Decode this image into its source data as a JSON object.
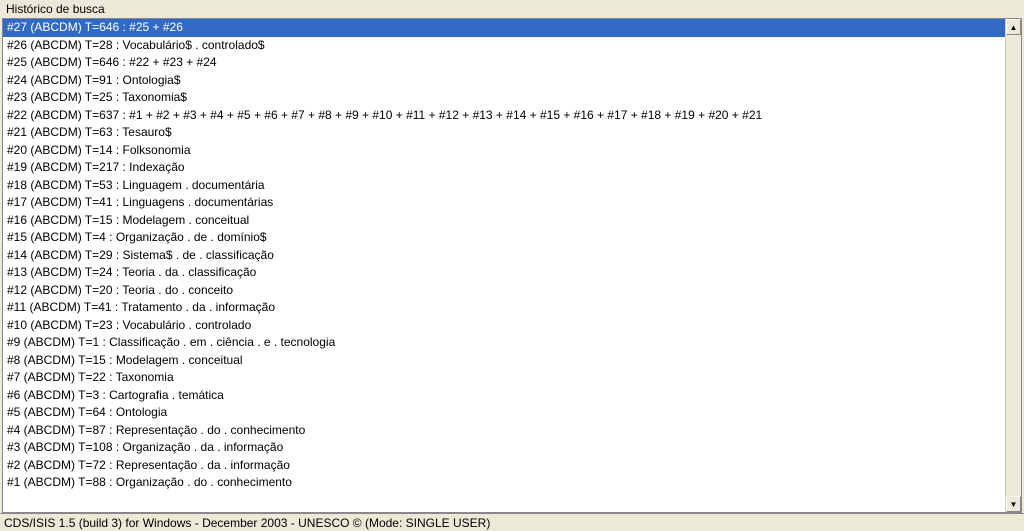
{
  "header": {
    "label": "Histórico de busca"
  },
  "history": {
    "items": [
      "#27 (ABCDM) T=646 : #25 + #26",
      "#26 (ABCDM) T=28 : Vocabulário$ . controlado$",
      "#25 (ABCDM) T=646 : #22 + #23 + #24",
      "#24 (ABCDM) T=91 : Ontologia$",
      "#23 (ABCDM) T=25 : Taxonomia$",
      "#22 (ABCDM) T=637 : #1 + #2 + #3 + #4 + #5 + #6 + #7 + #8 + #9 + #10 + #11 + #12 + #13 + #14 + #15 + #16 + #17 + #18 + #19 + #20 + #21",
      "#21 (ABCDM) T=63 : Tesauro$",
      "#20 (ABCDM) T=14 : Folksonomia",
      "#19 (ABCDM) T=217 : Indexação",
      "#18 (ABCDM) T=53 : Linguagem . documentária",
      "#17 (ABCDM) T=41 : Linguagens . documentárias",
      "#16 (ABCDM) T=15 : Modelagem . conceitual",
      "#15 (ABCDM) T=4 : Organização . de . domínio$",
      "#14 (ABCDM) T=29 : Sistema$ . de . classificação",
      "#13 (ABCDM) T=24 : Teoria . da . classificação",
      "#12 (ABCDM) T=20 : Teoria . do . conceito",
      "#11 (ABCDM) T=41 : Tratamento . da . informação",
      "#10 (ABCDM) T=23 : Vocabulário . controlado",
      "#9 (ABCDM) T=1 : Classificação . em . ciência . e . tecnologia",
      "#8 (ABCDM) T=15 : Modelagem . conceitual",
      "#7 (ABCDM) T=22 : Taxonomia",
      "#6 (ABCDM) T=3 : Cartografia . temática",
      "#5 (ABCDM) T=64 : Ontologia",
      "#4 (ABCDM) T=87 : Representação . do . conhecimento",
      "#3 (ABCDM) T=108 : Organização . da . informação",
      "#2 (ABCDM) T=72 : Representação . da . informação",
      "#1 (ABCDM) T=88 : Organização . do . conhecimento"
    ],
    "selected_index": 0
  },
  "status": {
    "text": "CDS/ISIS 1.5 (build 3) for Windows - December 2003 - UNESCO © (Mode: SINGLE USER)"
  },
  "scrollbar": {
    "up_arrow": "▲",
    "down_arrow": "▼"
  }
}
